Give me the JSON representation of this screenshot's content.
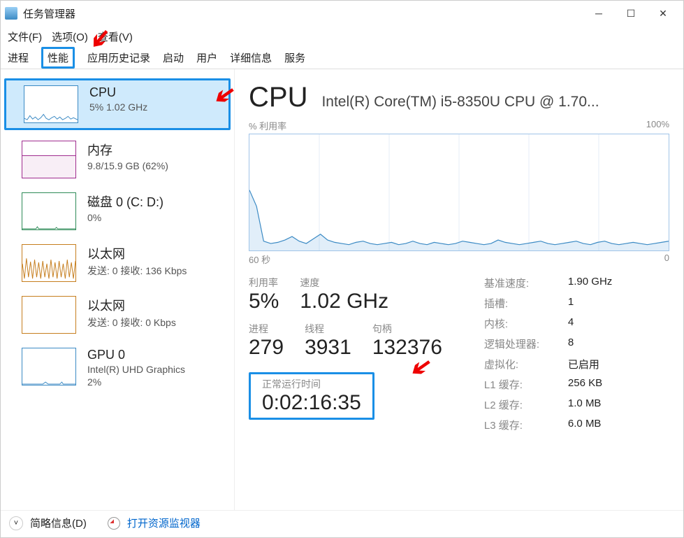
{
  "window": {
    "title": "任务管理器"
  },
  "menu": {
    "file": "文件(F)",
    "options": "选项(O)",
    "view": "查看(V)"
  },
  "tabs": {
    "processes": "进程",
    "performance": "性能",
    "history": "应用历史记录",
    "startup": "启动",
    "users": "用户",
    "details": "详细信息",
    "services": "服务"
  },
  "sidebar": {
    "cpu": {
      "title": "CPU",
      "sub": "5%  1.02 GHz"
    },
    "mem": {
      "title": "内存",
      "sub": "9.8/15.9 GB (62%)"
    },
    "disk": {
      "title": "磁盘 0 (C: D:)",
      "sub": "0%"
    },
    "net1": {
      "title": "以太网",
      "sub": "发送: 0 接收: 136 Kbps"
    },
    "net2": {
      "title": "以太网",
      "sub": "发送: 0 接收: 0 Kbps"
    },
    "gpu": {
      "title": "GPU 0",
      "sub": "Intel(R) UHD Graphics",
      "sub2": "2%"
    }
  },
  "main": {
    "heading": "CPU",
    "model": "Intel(R) Core(TM) i5-8350U CPU @ 1.70...",
    "chart_top_left": "% 利用率",
    "chart_top_right": "100%",
    "chart_bottom_left": "60 秒",
    "chart_bottom_right": "0",
    "util_lbl": "利用率",
    "util_val": "5%",
    "speed_lbl": "速度",
    "speed_val": "1.02 GHz",
    "proc_lbl": "进程",
    "proc_val": "279",
    "thread_lbl": "线程",
    "thread_val": "3931",
    "handle_lbl": "句柄",
    "handle_val": "132376",
    "uptime_lbl": "正常运行时间",
    "uptime_val": "0:02:16:35",
    "base_lbl": "基准速度:",
    "base_val": "1.90 GHz",
    "sockets_lbl": "插槽:",
    "sockets_val": "1",
    "cores_lbl": "内核:",
    "cores_val": "4",
    "logical_lbl": "逻辑处理器:",
    "logical_val": "8",
    "virt_lbl": "虚拟化:",
    "virt_val": "已启用",
    "l1_lbl": "L1 缓存:",
    "l1_val": "256 KB",
    "l2_lbl": "L2 缓存:",
    "l2_val": "1.0 MB",
    "l3_lbl": "L3 缓存:",
    "l3_val": "6.0 MB"
  },
  "footer": {
    "fewer": "简略信息(D)",
    "resmon": "打开资源监视器"
  },
  "chart_data": {
    "type": "line",
    "title": "% 利用率",
    "xlabel": "60 秒",
    "ylabel": "",
    "ylim": [
      0,
      100
    ],
    "xrange_seconds": 60,
    "series": [
      {
        "name": "CPU 利用率",
        "values": [
          52,
          38,
          8,
          6,
          7,
          9,
          12,
          8,
          6,
          10,
          14,
          9,
          7,
          6,
          5,
          7,
          8,
          6,
          5,
          6,
          7,
          5,
          6,
          8,
          6,
          5,
          7,
          6,
          5,
          6,
          8,
          7,
          6,
          5,
          6,
          9,
          7,
          6,
          5,
          6,
          7,
          8,
          6,
          5,
          6,
          7,
          8,
          6,
          5,
          7,
          8,
          6,
          5,
          6,
          7,
          6,
          5,
          6,
          7,
          8
        ]
      }
    ]
  }
}
